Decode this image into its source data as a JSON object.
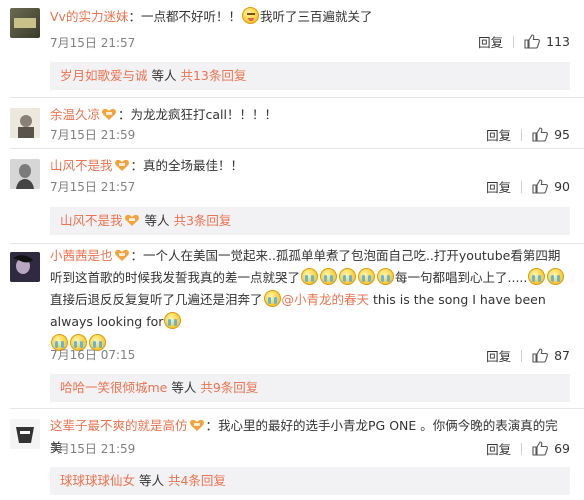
{
  "comments": [
    {
      "username": "Vv的实力迷妹",
      "text_a": "：一点都不好听！！",
      "text_b": "我听了三百遍就关了",
      "time": "7月15日 21:57",
      "reply_label": "回复",
      "likes": "113",
      "thread": {
        "user": "岁月如歌爱与诚",
        "mid": " 等人 ",
        "count": "共13条回复"
      }
    },
    {
      "username": "余温久凉",
      "text_a": "：为龙龙疯狂打call！！！！",
      "time": "7月15日 21:59",
      "reply_label": "回复",
      "likes": "95"
    },
    {
      "username": "山风不是我",
      "text_a": "：真的全场最佳！！",
      "time": "7月15日 21:57",
      "reply_label": "回复",
      "likes": "90",
      "thread": {
        "user": "山风不是我",
        "mid": " 等人 ",
        "count": "共3条回复"
      }
    },
    {
      "username": "小茜茜是也",
      "text_a": "：一个人在美国一觉起来..孤孤单单煮了包泡面自己吃..打开youtube看第四期听到这首歌的时候我发誓我真的差一点就哭了",
      "text_b": "每一句都唱到心上了.....",
      "text_c": "直接后退反反复复听了几遍还是泪奔了",
      "mention": "@小青龙的春天",
      "text_d": " this is the song I have been always looking for",
      "time": "7月16日 07:15",
      "reply_label": "回复",
      "likes": "87",
      "thread": {
        "user": "哈哈一笑很倾城me",
        "mid": " 等人 ",
        "count": "共9条回复"
      }
    },
    {
      "username": "这辈子最不爽的就是高仿",
      "text_a": "：我心里的最好的选手小青龙PG ONE 。你俩今晚的表演真的完美",
      "time": "7月15日 21:59",
      "reply_label": "回复",
      "likes": "69",
      "thread": {
        "user": "球球球球仙女",
        "mid": " 等人 ",
        "count": "共4条回复"
      }
    }
  ],
  "icons": {
    "like": "thumbs-up-icon",
    "badge": "vip-heart-badge-icon",
    "emoji_cry": "crying-face-icon",
    "emoji_tease": "teasing-face-icon"
  },
  "colors": {
    "username": "#eb7350",
    "meta": "#808080",
    "thread_bg": "#f2f2f5"
  }
}
